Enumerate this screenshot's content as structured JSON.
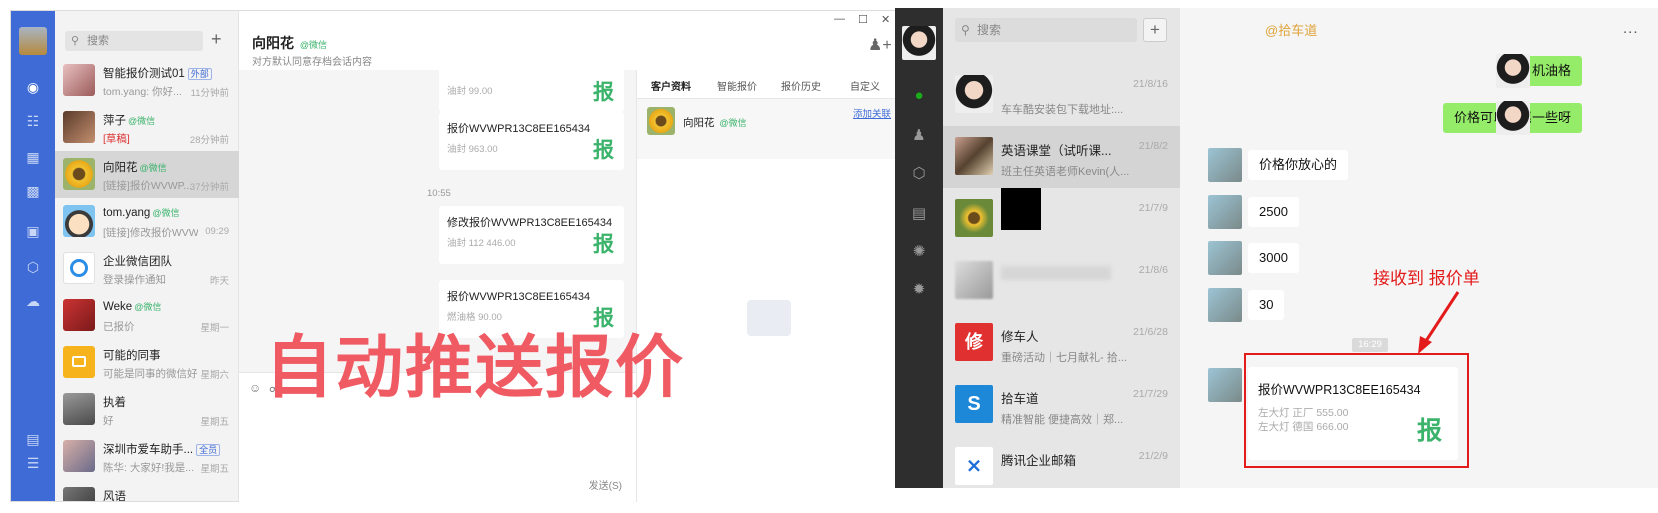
{
  "left_app": {
    "search_placeholder": "搜索",
    "conversations": [
      {
        "name": "智能报价测试01",
        "tag": "外部",
        "preview": "tom.yang: 你好...",
        "time": "11分钟前"
      },
      {
        "name": "萍子",
        "tag": "@微信",
        "preview": "[草稿]",
        "time": "28分钟前"
      },
      {
        "name": "向阳花",
        "tag": "@微信",
        "preview": "[链接]报价WVWP...",
        "time": "37分钟前"
      },
      {
        "name": "tom.yang",
        "tag": "@微信",
        "preview": "[链接]修改报价WVWP...",
        "time": "09:29"
      },
      {
        "name": "企业微信团队",
        "tag": "",
        "preview": "登录操作通知",
        "time": "昨天"
      },
      {
        "name": "Weke",
        "tag": "@微信",
        "preview": "已报价",
        "time": "星期一"
      },
      {
        "name": "可能的同事",
        "tag": "",
        "preview": "可能是同事的微信好...",
        "time": "星期六"
      },
      {
        "name": "执着",
        "tag": "",
        "preview": "好",
        "time": "星期五"
      },
      {
        "name": "深圳市爱车助手...",
        "tag": "全员",
        "preview": "陈华: 大家好!我是...",
        "time": "星期五"
      },
      {
        "name": "风语",
        "tag": "",
        "preview": "",
        "time": ""
      }
    ],
    "chat": {
      "title": "向阳花",
      "title_tag": "@微信",
      "subtitle": "对方默认同意存档会话内容",
      "cards": [
        {
          "title": "",
          "detail": "油封 99.00",
          "badge": "报"
        },
        {
          "title": "报价WVWPR13C8EE165434",
          "detail": "油封 963.00",
          "badge": "报"
        },
        {
          "title": "修改报价WVWPR13C8EE165434",
          "detail": "油封 112 446.00",
          "badge": "报"
        },
        {
          "title": "报价WVWPR13C8EE165434",
          "detail": "燃油格 90.00",
          "badge": "报"
        }
      ],
      "time_marker": "10:55",
      "send_label": "发送(S)"
    },
    "side_panel": {
      "tabs": [
        "客户资料",
        "智能报价",
        "报价历史",
        "自定义"
      ],
      "contact_name": "向阳花",
      "contact_tag": "@微信",
      "add_link": "添加关联"
    },
    "overlay_text": "自动推送报价"
  },
  "right_app": {
    "search_placeholder": "搜索",
    "conversations": [
      {
        "name": "",
        "preview": "车车酷安装包下载地址:...",
        "time": "21/8/16"
      },
      {
        "name": "英语课堂（试听课...",
        "preview": "班主任英语老师Kevin(人...",
        "time": "21/8/2"
      },
      {
        "name": "",
        "preview": "",
        "time": "21/7/9"
      },
      {
        "name": "",
        "preview": "",
        "time": "21/8/6"
      },
      {
        "name": "修车人",
        "preview": "重磅活动｜七月献礼- 拾...",
        "time": "21/6/28"
      },
      {
        "name": "拾车道",
        "preview": "精准智能 便捷高效｜郑...",
        "time": "21/7/29"
      },
      {
        "name": "腾讯企业邮箱",
        "preview": "",
        "time": "21/2/9"
      }
    ],
    "chat": {
      "title": "@拾车道",
      "more": "...",
      "messages": [
        {
          "side": "right",
          "text": "机油格"
        },
        {
          "side": "right",
          "text": "价格可以优惠一些呀"
        },
        {
          "side": "left",
          "text": "价格你放心的"
        },
        {
          "side": "left",
          "text": "2500"
        },
        {
          "side": "left",
          "text": "3000"
        },
        {
          "side": "left",
          "text": "30"
        }
      ],
      "time_marker": "16:29",
      "card": {
        "title": "报价WVWPR13C8EE165434",
        "line1": "左大灯 正厂 555.00",
        "line2": "左大灯 德国 666.00",
        "badge": "报"
      },
      "annotation": "接收到 报价单"
    }
  },
  "colors": {
    "wecom_blue": "#3e6bd6",
    "wechat_green": "#1aad19",
    "bubble_green": "#95ec69",
    "quote_green": "#3bb36b",
    "annotation_red": "#e31b1b",
    "banner_red": "#ef5a63"
  }
}
